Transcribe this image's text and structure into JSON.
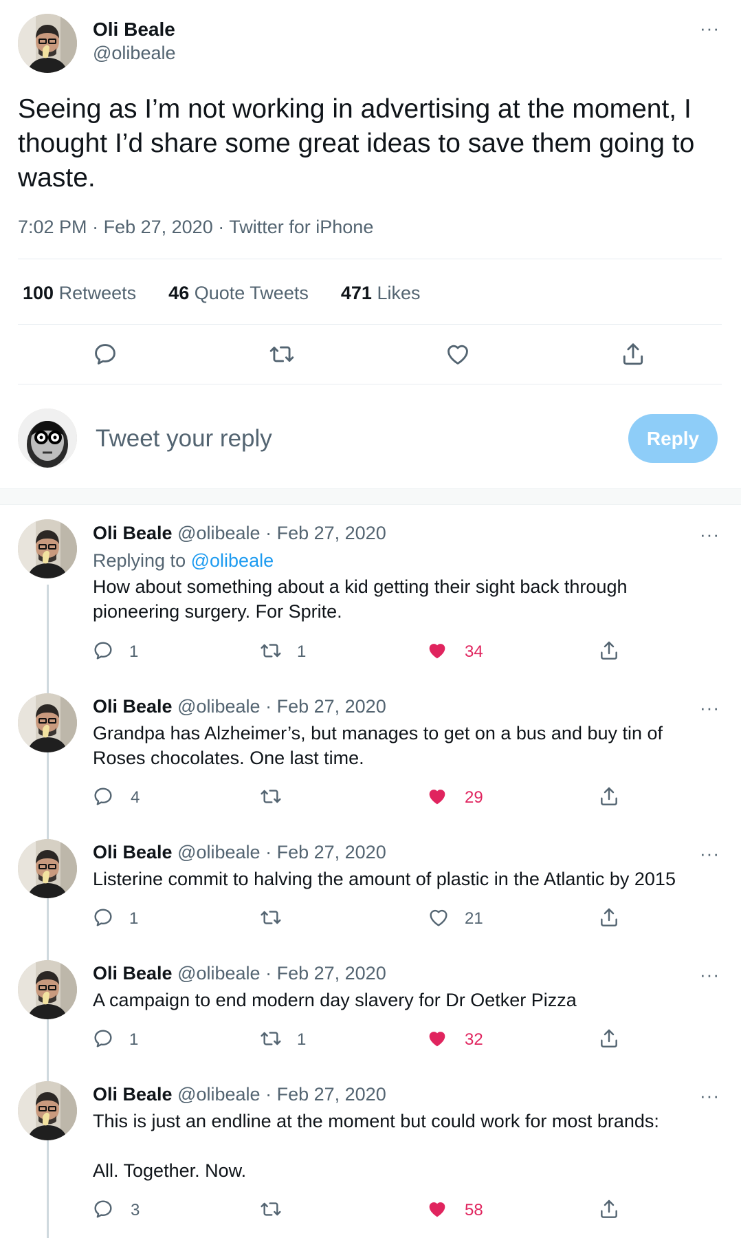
{
  "main_tweet": {
    "name": "Oli Beale",
    "handle": "@olibeale",
    "text": "Seeing as I’m not working in advertising at the moment, I thought I’d share some great ideas to save them going to waste.",
    "time": "7:02 PM",
    "date": "Feb 27, 2020",
    "source": "Twitter for iPhone",
    "retweets_count": "100",
    "retweets_label": "Retweets",
    "quotes_count": "46",
    "quotes_label": "Quote Tweets",
    "likes_count": "471",
    "likes_label": "Likes",
    "more": "···"
  },
  "compose": {
    "placeholder": "Tweet your reply",
    "button": "Reply"
  },
  "replies": [
    {
      "name": "Oli Beale",
      "handle": "@olibeale",
      "date": "· Feb 27, 2020",
      "replying_prefix": "Replying to",
      "replying_handle": "@olibeale",
      "text_line1": "How about something about a kid getting their sight back through",
      "text_line2": "pioneering surgery. For Sprite.",
      "replies": "1",
      "retweets": "1",
      "likes": "34",
      "liked": true,
      "more": "···"
    },
    {
      "name": "Oli Beale",
      "handle": "@olibeale",
      "date": "· Feb 27, 2020",
      "text_line1": "Grandpa has Alzheimer’s, but manages to get on a bus and buy tin of",
      "text_line2": "Roses chocolates. One last time.",
      "replies": "4",
      "retweets": "",
      "likes": "29",
      "liked": true,
      "more": "···"
    },
    {
      "name": "Oli Beale",
      "handle": "@olibeale",
      "date": "· Feb 27, 2020",
      "text_line1": "Listerine commit to halving the amount of plastic in the Atlantic by 2015",
      "replies": "1",
      "retweets": "",
      "likes": "21",
      "liked": false,
      "more": "···"
    },
    {
      "name": "Oli Beale",
      "handle": "@olibeale",
      "date": "· Feb 27, 2020",
      "text_line1": "A campaign to end modern day slavery for Dr Oetker Pizza",
      "replies": "1",
      "retweets": "1",
      "likes": "32",
      "liked": true,
      "more": "···"
    },
    {
      "name": "Oli Beale",
      "handle": "@olibeale",
      "date": "· Feb 27, 2020",
      "text_line1": "This is just an endline at the moment but could work for most brands:",
      "text_line2": "All. Together. Now.",
      "replies": "3",
      "retweets": "",
      "likes": "58",
      "liked": true,
      "more": "···"
    }
  ],
  "colors": {
    "accent": "#1d9bf0",
    "like": "#e0245e",
    "muted": "#536471",
    "reply_button": "#8ecdf8"
  }
}
